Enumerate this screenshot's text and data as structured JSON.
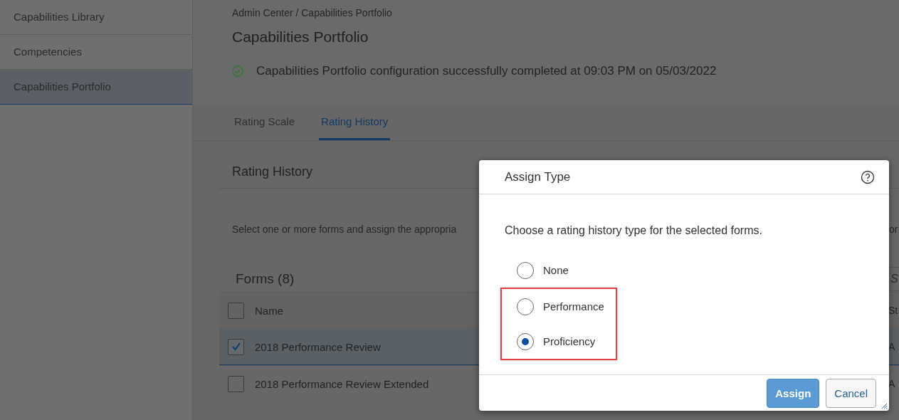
{
  "sidebar": {
    "items": [
      {
        "label": "Capabilities Library",
        "selected": false
      },
      {
        "label": "Competencies",
        "selected": false
      },
      {
        "label": "Capabilities Portfolio",
        "selected": true
      }
    ]
  },
  "breadcrumb": "Admin Center / Capabilities Portfolio",
  "page_title": "Capabilities Portfolio",
  "status_message": "Capabilities Portfolio configuration successfully completed at 09:03 PM on 05/03/2022",
  "tabs": [
    {
      "label": "Rating Scale",
      "selected": false
    },
    {
      "label": "Rating History",
      "selected": true
    }
  ],
  "section": {
    "title": "Rating History",
    "instruction": "Select one or more forms and assign the appropria",
    "instruction_end": "or",
    "search_placeholder": "S"
  },
  "forms": {
    "title": "Forms (8)",
    "all_checked": false,
    "columns": [
      "Name",
      "St"
    ],
    "rows": [
      {
        "name": "2018 Performance Review",
        "status": "A",
        "checked": true,
        "selected": true
      },
      {
        "name": "2018 Performance Review Extended",
        "status": "A",
        "checked": false,
        "selected": false
      }
    ]
  },
  "dialog": {
    "title": "Assign Type",
    "prompt": "Choose a rating history type for the selected forms.",
    "options": [
      {
        "label": "None",
        "selected": false,
        "highlighted": false
      },
      {
        "label": "Performance",
        "selected": false,
        "highlighted": true
      },
      {
        "label": "Proficiency",
        "selected": true,
        "highlighted": true
      }
    ],
    "buttons": [
      {
        "label": "Assign",
        "kind": "primary"
      },
      {
        "label": "Cancel",
        "kind": "secondary"
      }
    ]
  }
}
